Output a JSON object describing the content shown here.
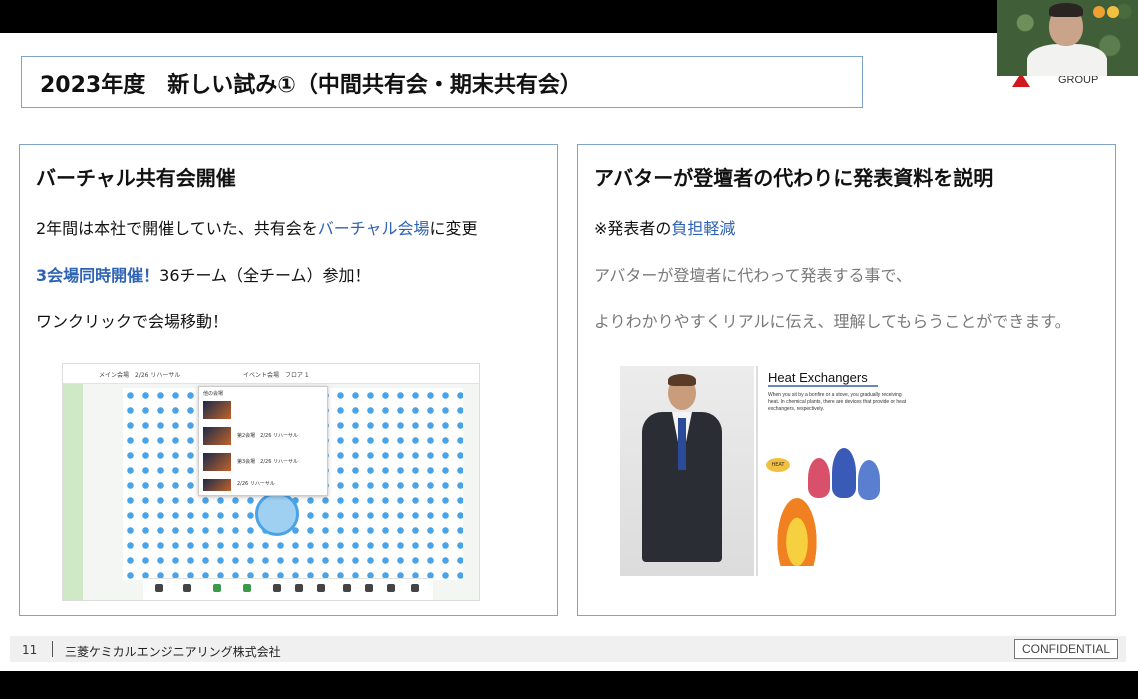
{
  "slide": {
    "title": "2023年度　新しい試み①（中間共有会・期末共有会）",
    "logo_text": "GROUP"
  },
  "left_panel": {
    "heading": "バーチャル共有会開催",
    "line1_prefix": "2年間は本社で開催していた、共有会を",
    "line1_highlight": "バーチャル会場",
    "line1_suffix": "に変更",
    "line2_highlight": "3会場同時開催！",
    "line2_suffix": "36チーム（全チーム）参加！",
    "line3": "ワンクリックで会場移動！",
    "screenshot": {
      "venue": "メイン会場　2/26 リハーサル",
      "center_label": "イベント会場　フロア 1",
      "popup_title": "他の会場",
      "rooms": [
        "第2会場　2/26 リハーサル",
        "第3会場　2/26 リハーサル",
        "2/26 リハーサル"
      ]
    }
  },
  "right_panel": {
    "heading": "アバターが登壇者の代わりに発表資料を説明",
    "note_prefix": "※発表者の",
    "note_highlight": "負担軽減",
    "line1": "アバターが登壇者に代わって発表する事で、",
    "line2": "よりわかりやすくリアルに伝え、理解してもらうことができます。",
    "image": {
      "slide_title": "Heat Exchangers",
      "slide_text": "When you sit by a bonfire or a stove, you gradually receiving heat. In chemical plants, there are devices that provide or heat exchangers, respectively.",
      "bubble": "HEAT"
    }
  },
  "footer": {
    "page_number": "11",
    "company": "三菱ケミカルエンジニアリング株式会社",
    "confidential": "CONFIDENTIAL"
  },
  "colors": {
    "accent_blue": "#2f63b3",
    "border_blue": "#7fa4c8",
    "logo_red": "#d0191c"
  }
}
